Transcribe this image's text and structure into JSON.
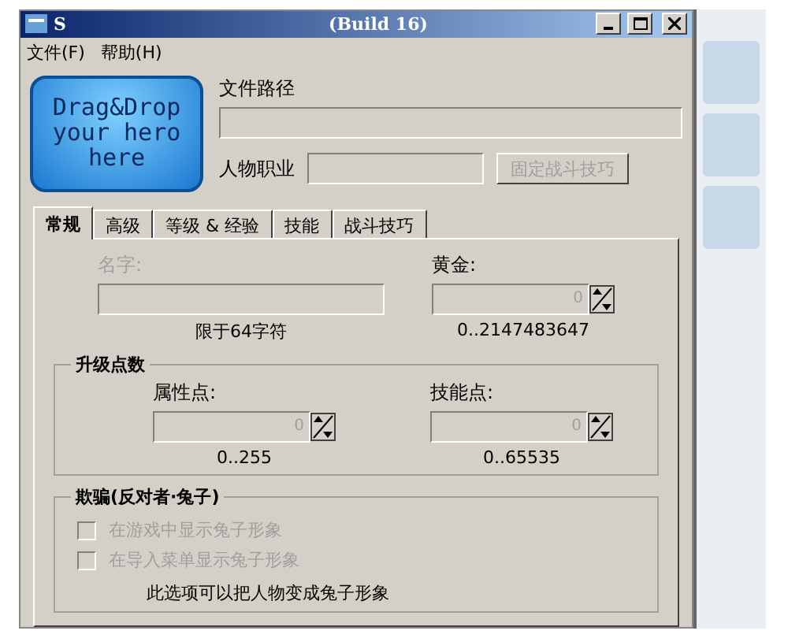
{
  "window": {
    "title": "S",
    "subtitle": "(Build 16)"
  },
  "menu": [
    {
      "label": "文件(F)"
    },
    {
      "label": "帮助(H)"
    }
  ],
  "hero_drop": {
    "lines": [
      "Drag&Drop",
      "your hero",
      "here"
    ]
  },
  "file_path": {
    "label": "文件路径"
  },
  "hero_class": {
    "label": "人物职业",
    "button": {
      "label": "固定战斗技巧",
      "disabled": true
    }
  },
  "tabs": [
    {
      "label": "常规",
      "selected": true
    },
    {
      "label": "高级",
      "selected": false
    },
    {
      "label": "等级 & 经验",
      "selected": false
    },
    {
      "label": "技能",
      "selected": false
    },
    {
      "label": "战斗技巧",
      "selected": false
    }
  ],
  "name": {
    "label": "名字:",
    "disabled": true,
    "hint": "限于64字符"
  },
  "gold": {
    "label": "黄金:",
    "value": "0",
    "range": "0..2147483647"
  },
  "level_points": {
    "title": "升级点数",
    "fields": [
      {
        "label": "属性点:",
        "value": "0",
        "range": "0..255"
      },
      {
        "label": "技能点:",
        "value": "0",
        "range": "0..65535"
      }
    ]
  },
  "cheat": {
    "title": "欺骗(反对者·兔子)",
    "options": [
      {
        "label": "在游戏中显示兔子形象",
        "checked": false,
        "disabled": true
      },
      {
        "label": "在导入菜单显示兔子形象",
        "checked": false,
        "disabled": true
      }
    ],
    "note": "此选项可以把人物变成兔子形象"
  }
}
